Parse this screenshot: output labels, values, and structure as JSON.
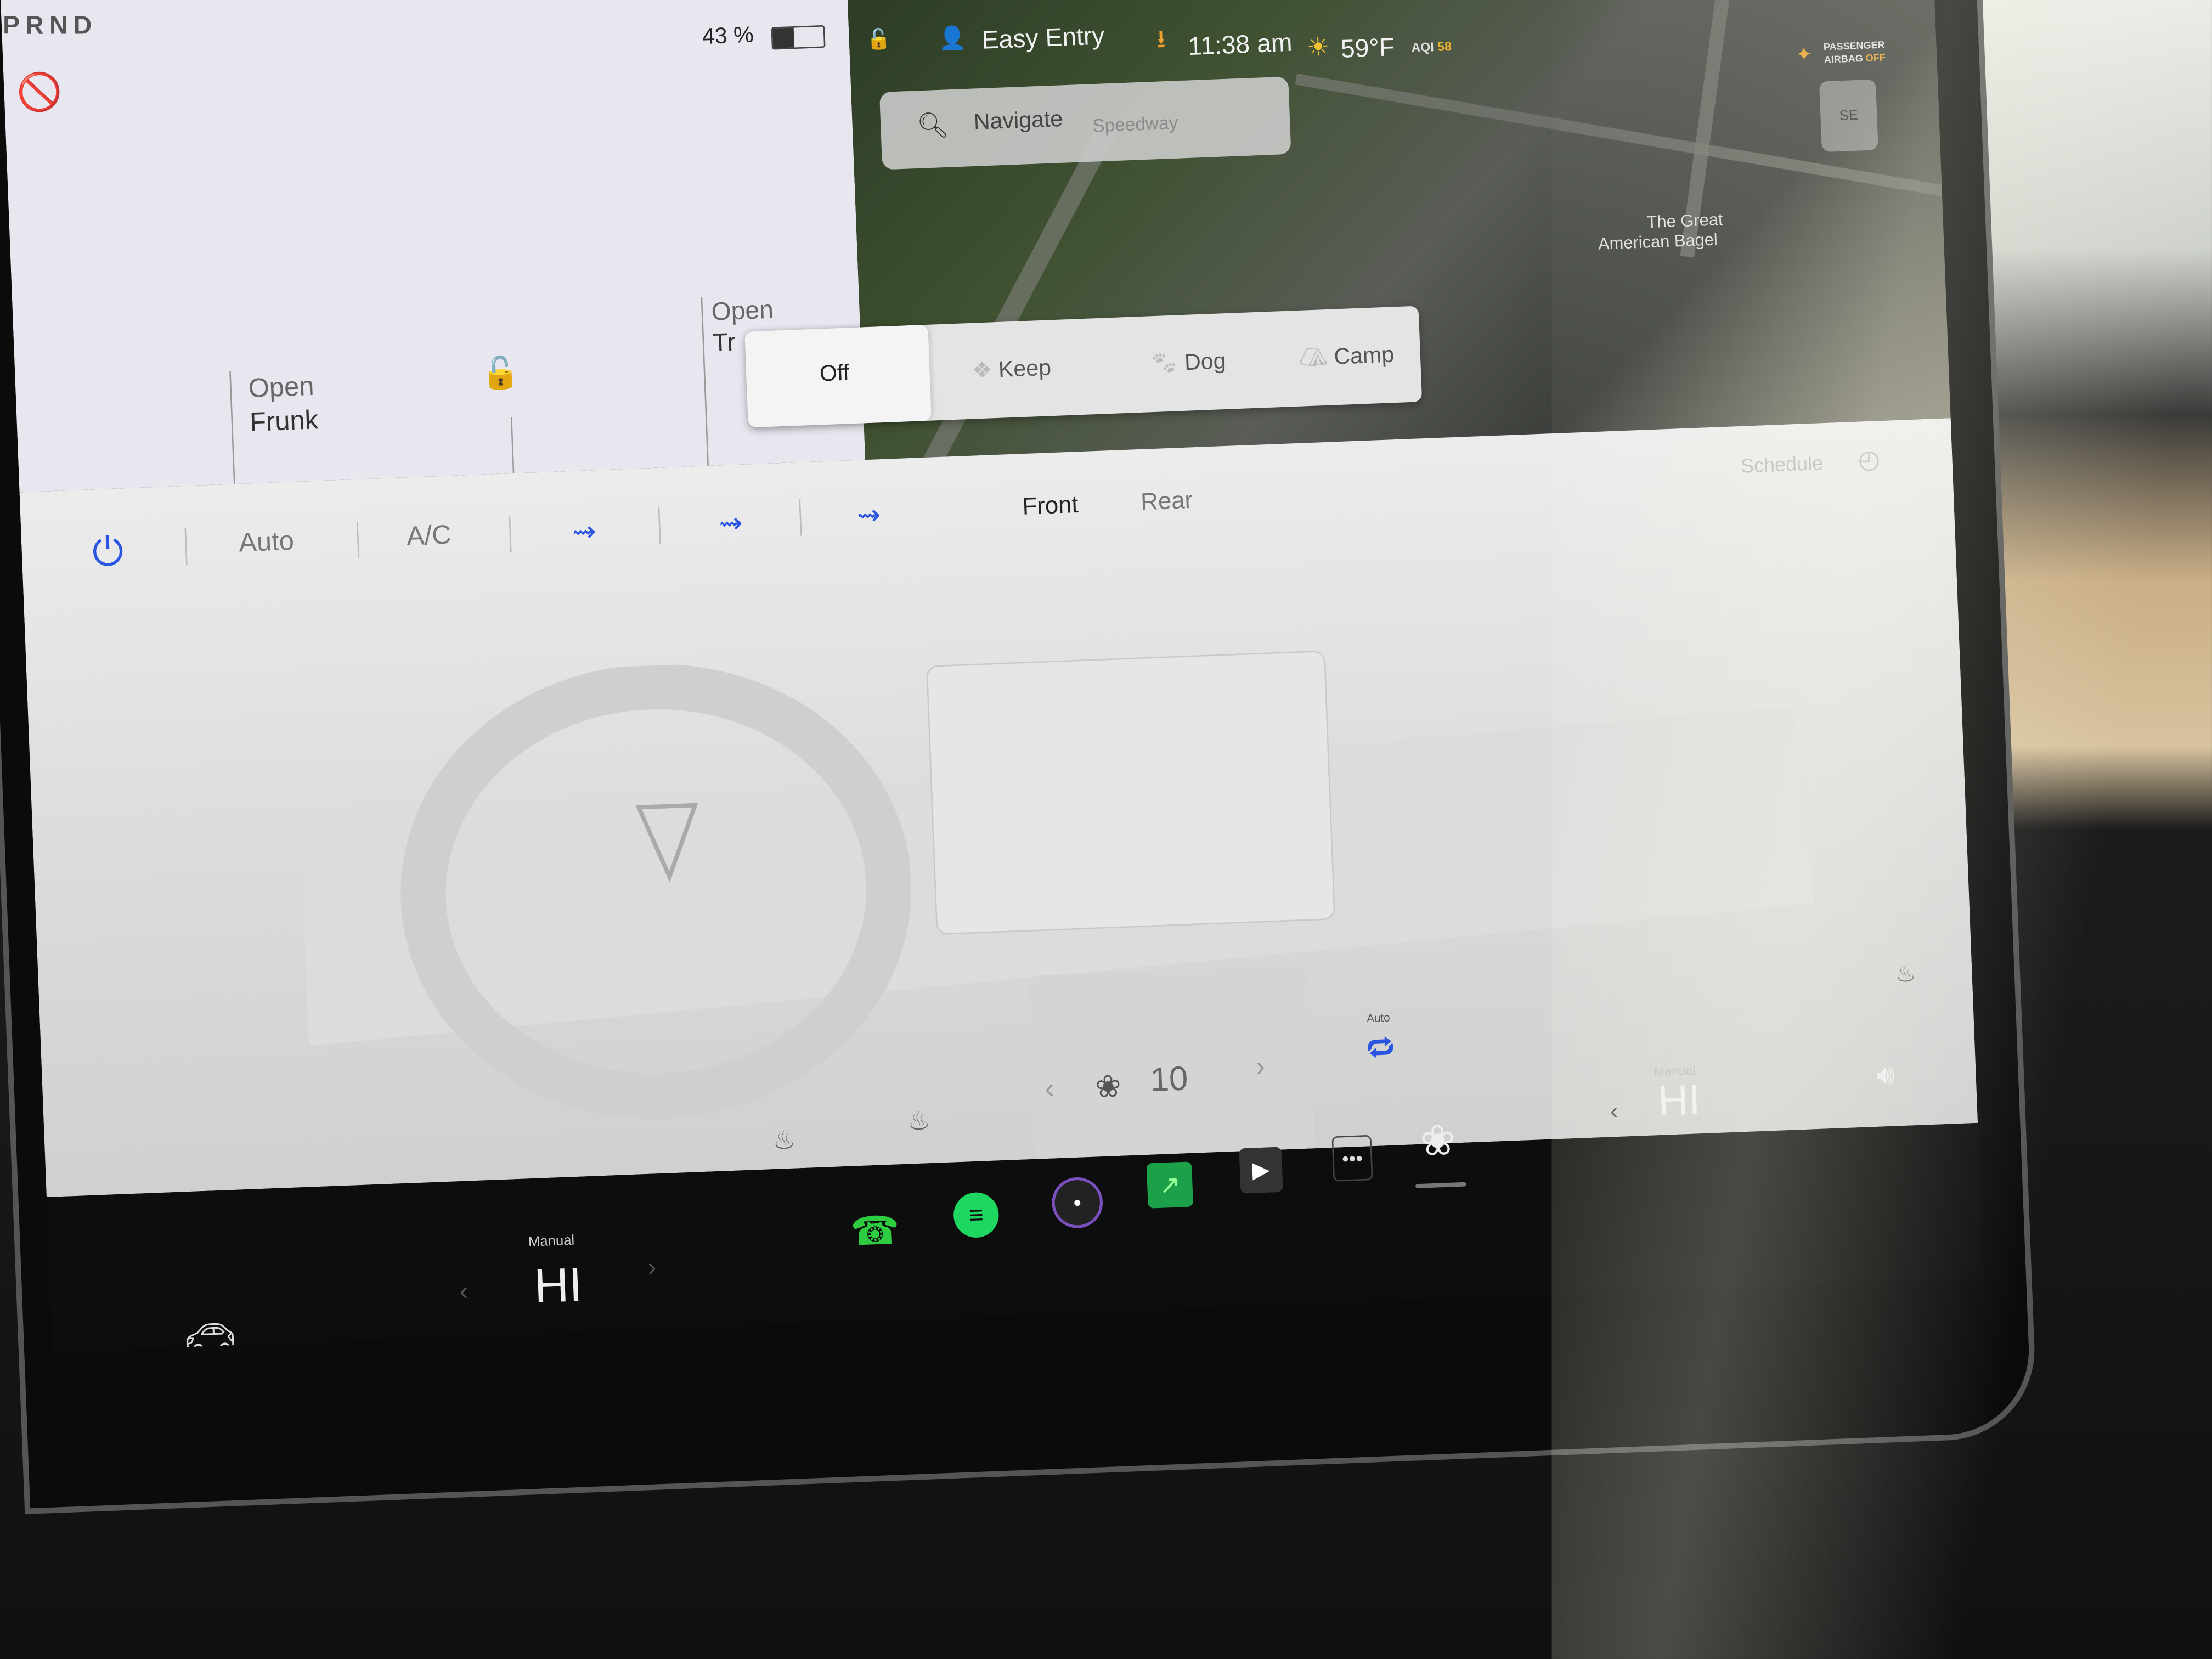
{
  "gear": "PRND",
  "battery": {
    "percent_label": "43 %",
    "level": 0.43
  },
  "status_bar": {
    "profile": "Easy Entry",
    "time": "11:38 am",
    "temperature": "59°F",
    "aqi_label": "AQI",
    "aqi_value": "58",
    "airbag_line1": "PASSENGER",
    "airbag_line2": "AIRBAG",
    "airbag_state": "OFF"
  },
  "search": {
    "placeholder": "Navigate"
  },
  "map": {
    "labels": [
      "Speedway",
      "The Great",
      "American Bagel"
    ],
    "compass": "SE"
  },
  "car_panel": {
    "frunk_line1": "Open",
    "frunk_line2": "Frunk",
    "trunk_line1": "Open",
    "trunk_line2": "Tr"
  },
  "climate_keeper": {
    "options": [
      "Off",
      "Keep",
      "Dog",
      "Camp"
    ],
    "selected": "Off"
  },
  "climate": {
    "auto_label": "Auto",
    "ac_label": "A/C",
    "front_label": "Front",
    "rear_label": "Rear",
    "schedule_label": "Schedule",
    "fan_speed": "10",
    "recirc_label": "Auto",
    "accent_color": "#2a55e0"
  },
  "bottom_bar": {
    "driver_temp_mode": "Manual",
    "driver_temp": "HI",
    "passenger_temp_mode": "Manual",
    "passenger_temp": "HI"
  }
}
